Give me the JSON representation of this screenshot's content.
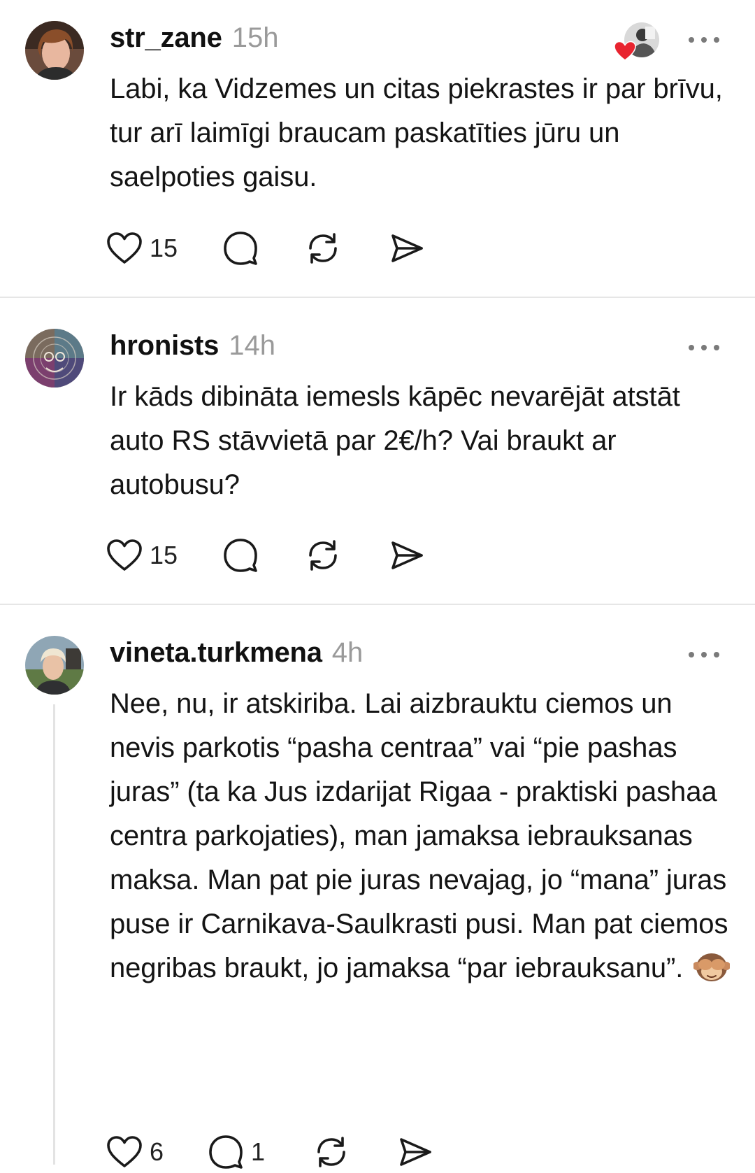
{
  "posts": [
    {
      "username": "str_zane",
      "time": "15h",
      "text": "Labi, ka Vidzemes un citas piekrastes ir par brīvu, tur arī laimīgi braucam paskatīties jūru un saelpoties gaisu.",
      "likes": "15",
      "replies": ""
    },
    {
      "username": "hronists",
      "time": "14h",
      "text": "Ir kāds dibināta iemesls kāpēc nevarējāt atstāt auto RS stāvvietā par 2€/h? Vai braukt ar autobusu?",
      "likes": "15",
      "replies": ""
    },
    {
      "username": "vineta.turkmena",
      "time": "4h",
      "text": "Nee, nu, ir atskiriba. Lai aizbrauktu ciemos un nevis parkotis “pasha centraa” vai “pie pashas juras” (ta ka Jus izdarijat Rigaa - praktiski pashaa centra parkojaties), man jamaksa iebrauksanas maksa. Man pat pie juras nevajag, jo “mana” juras puse ir Carnikava-Saulkrasti pusi. Man pat ciemos negribas braukt, jo jamaksa “par iebrauksanu”.",
      "emoji": "see-no-evil-monkey",
      "likes": "6",
      "replies": "1"
    }
  ],
  "colors": {
    "text": "#141414",
    "muted": "#9a9a9a",
    "divider": "#e6e6e6",
    "heart": "#e8242f"
  }
}
